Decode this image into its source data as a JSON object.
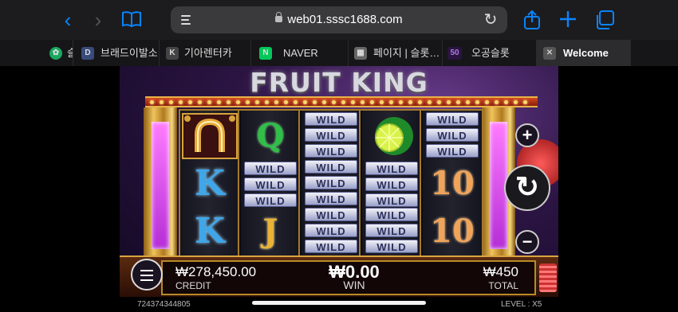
{
  "browser": {
    "url": "web01.sssc1688.com",
    "back_icon": "‹",
    "forward_icon": "›",
    "reload_icon": "↻"
  },
  "tabs": [
    {
      "label": "슬",
      "favicon": "✿",
      "favicon_color": "#1aa860"
    },
    {
      "label": "브래드이발소…",
      "favicon": "D",
      "favicon_color": "#3a4a7a"
    },
    {
      "label": "기아렌터카",
      "favicon": "K",
      "favicon_color": "#444444"
    },
    {
      "label": "NAVER",
      "favicon": "N",
      "favicon_color": "#03c75a"
    },
    {
      "label": "페이지 | 슬롯…",
      "favicon": "▦",
      "favicon_color": "#666666"
    },
    {
      "label": "오공슬롯",
      "favicon": "50",
      "favicon_color": "#6a3a9a"
    },
    {
      "label": "Welcome",
      "favicon": "✕",
      "favicon_color": "#555555",
      "active": true
    }
  ],
  "game": {
    "title": "FRUIT KING",
    "reels": [
      {
        "symbols": [
          "horseshoe",
          "K",
          "K"
        ]
      },
      {
        "symbols": [
          "Q",
          "WILD",
          "J"
        ]
      },
      {
        "symbols": [
          "WILD",
          "WILD",
          "WILD"
        ]
      },
      {
        "symbols": [
          "lime",
          "WILD",
          "WILD"
        ]
      },
      {
        "symbols": [
          "WILD",
          "10",
          "10"
        ]
      }
    ],
    "symbol_text": {
      "k": "K",
      "q": "Q",
      "j": "J",
      "ten": "10",
      "wild": "WILD"
    },
    "hud": {
      "credit_value": "₩278,450.00",
      "credit_label": "CREDIT",
      "win_value": "₩0.00",
      "win_label": "WIN",
      "total_value": "₩450",
      "total_label": "TOTAL"
    },
    "controls": {
      "plus_icon": "+",
      "minus_icon": "−",
      "spin_icon": "↻"
    },
    "session_id": "724374344805",
    "level": "LEVEL : X5"
  }
}
